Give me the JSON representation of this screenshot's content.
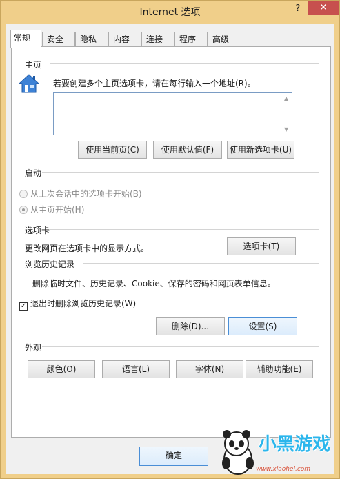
{
  "window": {
    "title": "Internet 选项",
    "help": "?",
    "close": "✕"
  },
  "tabs": [
    {
      "label": "常规",
      "active": true
    },
    {
      "label": "安全"
    },
    {
      "label": "隐私"
    },
    {
      "label": "内容"
    },
    {
      "label": "连接"
    },
    {
      "label": "程序"
    },
    {
      "label": "高级"
    }
  ],
  "home": {
    "section": "主页",
    "hint": "若要创建多个主页选项卡，请在每行输入一个地址(R)。",
    "urls": "",
    "buttons": {
      "use_current": "使用当前页(C)",
      "use_default": "使用默认值(F)",
      "use_new_tab": "使用新选项卡(U)"
    }
  },
  "startup": {
    "section": "启动",
    "options": [
      {
        "label": "从上次会话中的选项卡开始(B)",
        "checked": false,
        "disabled": true
      },
      {
        "label": "从主页开始(H)",
        "checked": true,
        "disabled": true
      }
    ]
  },
  "tabs_section": {
    "section": "选项卡",
    "text": "更改网页在选项卡中的显示方式。",
    "button": "选项卡(T)"
  },
  "history": {
    "section": "浏览历史记录",
    "text": "删除临时文件、历史记录、Cookie、保存的密码和网页表单信息。",
    "checkbox_label": "退出时删除浏览历史记录(W)",
    "checkbox_checked": true,
    "delete_button": "删除(D)...",
    "settings_button": "设置(S)"
  },
  "appearance": {
    "section": "外观",
    "buttons": {
      "colors": "颜色(O)",
      "languages": "语言(L)",
      "fonts": "字体(N)",
      "accessibility": "辅助功能(E)"
    }
  },
  "footer": {
    "ok": "确定"
  },
  "watermark": {
    "brand": "小黑游戏",
    "url": "www.xiaohei.com"
  },
  "colors": {
    "titlebar": "#f0cf8a",
    "close": "#c7504e",
    "focus_border": "#4a8ed6"
  }
}
